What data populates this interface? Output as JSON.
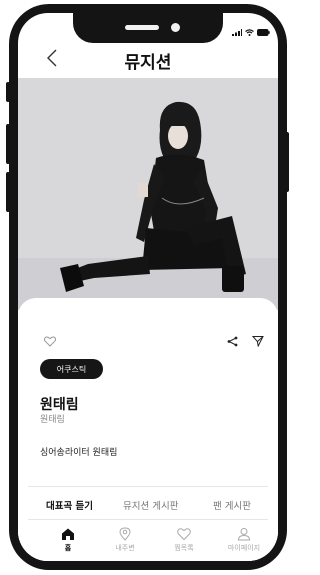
{
  "status_bar": {
    "signal": "signal-icon",
    "wifi": "wifi-icon",
    "battery": "battery-icon"
  },
  "header": {
    "title": "뮤지션",
    "back_icon": "back-arrow-icon"
  },
  "profile": {
    "image": "musician-photo",
    "tag": "어쿠스틱",
    "name": "원태림",
    "subname": "원태림",
    "description": "싱어송라이터 원태림"
  },
  "tabs": [
    {
      "label": "대표곡 듣기",
      "active": true
    },
    {
      "label": "뮤지션 게시판",
      "active": false
    },
    {
      "label": "팬 게시판",
      "active": false
    }
  ],
  "bottom_nav": [
    {
      "label": "홈",
      "icon": "home-icon",
      "active": true
    },
    {
      "label": "내주변",
      "icon": "location-pin-icon",
      "active": false
    },
    {
      "label": "찜목록",
      "icon": "heart-icon",
      "active": false
    },
    {
      "label": "마이페이지",
      "icon": "person-icon",
      "active": false
    }
  ],
  "colors": {
    "frame": "#141414",
    "photo_bg": "#d6d6d9",
    "tag_bg": "#161616"
  }
}
